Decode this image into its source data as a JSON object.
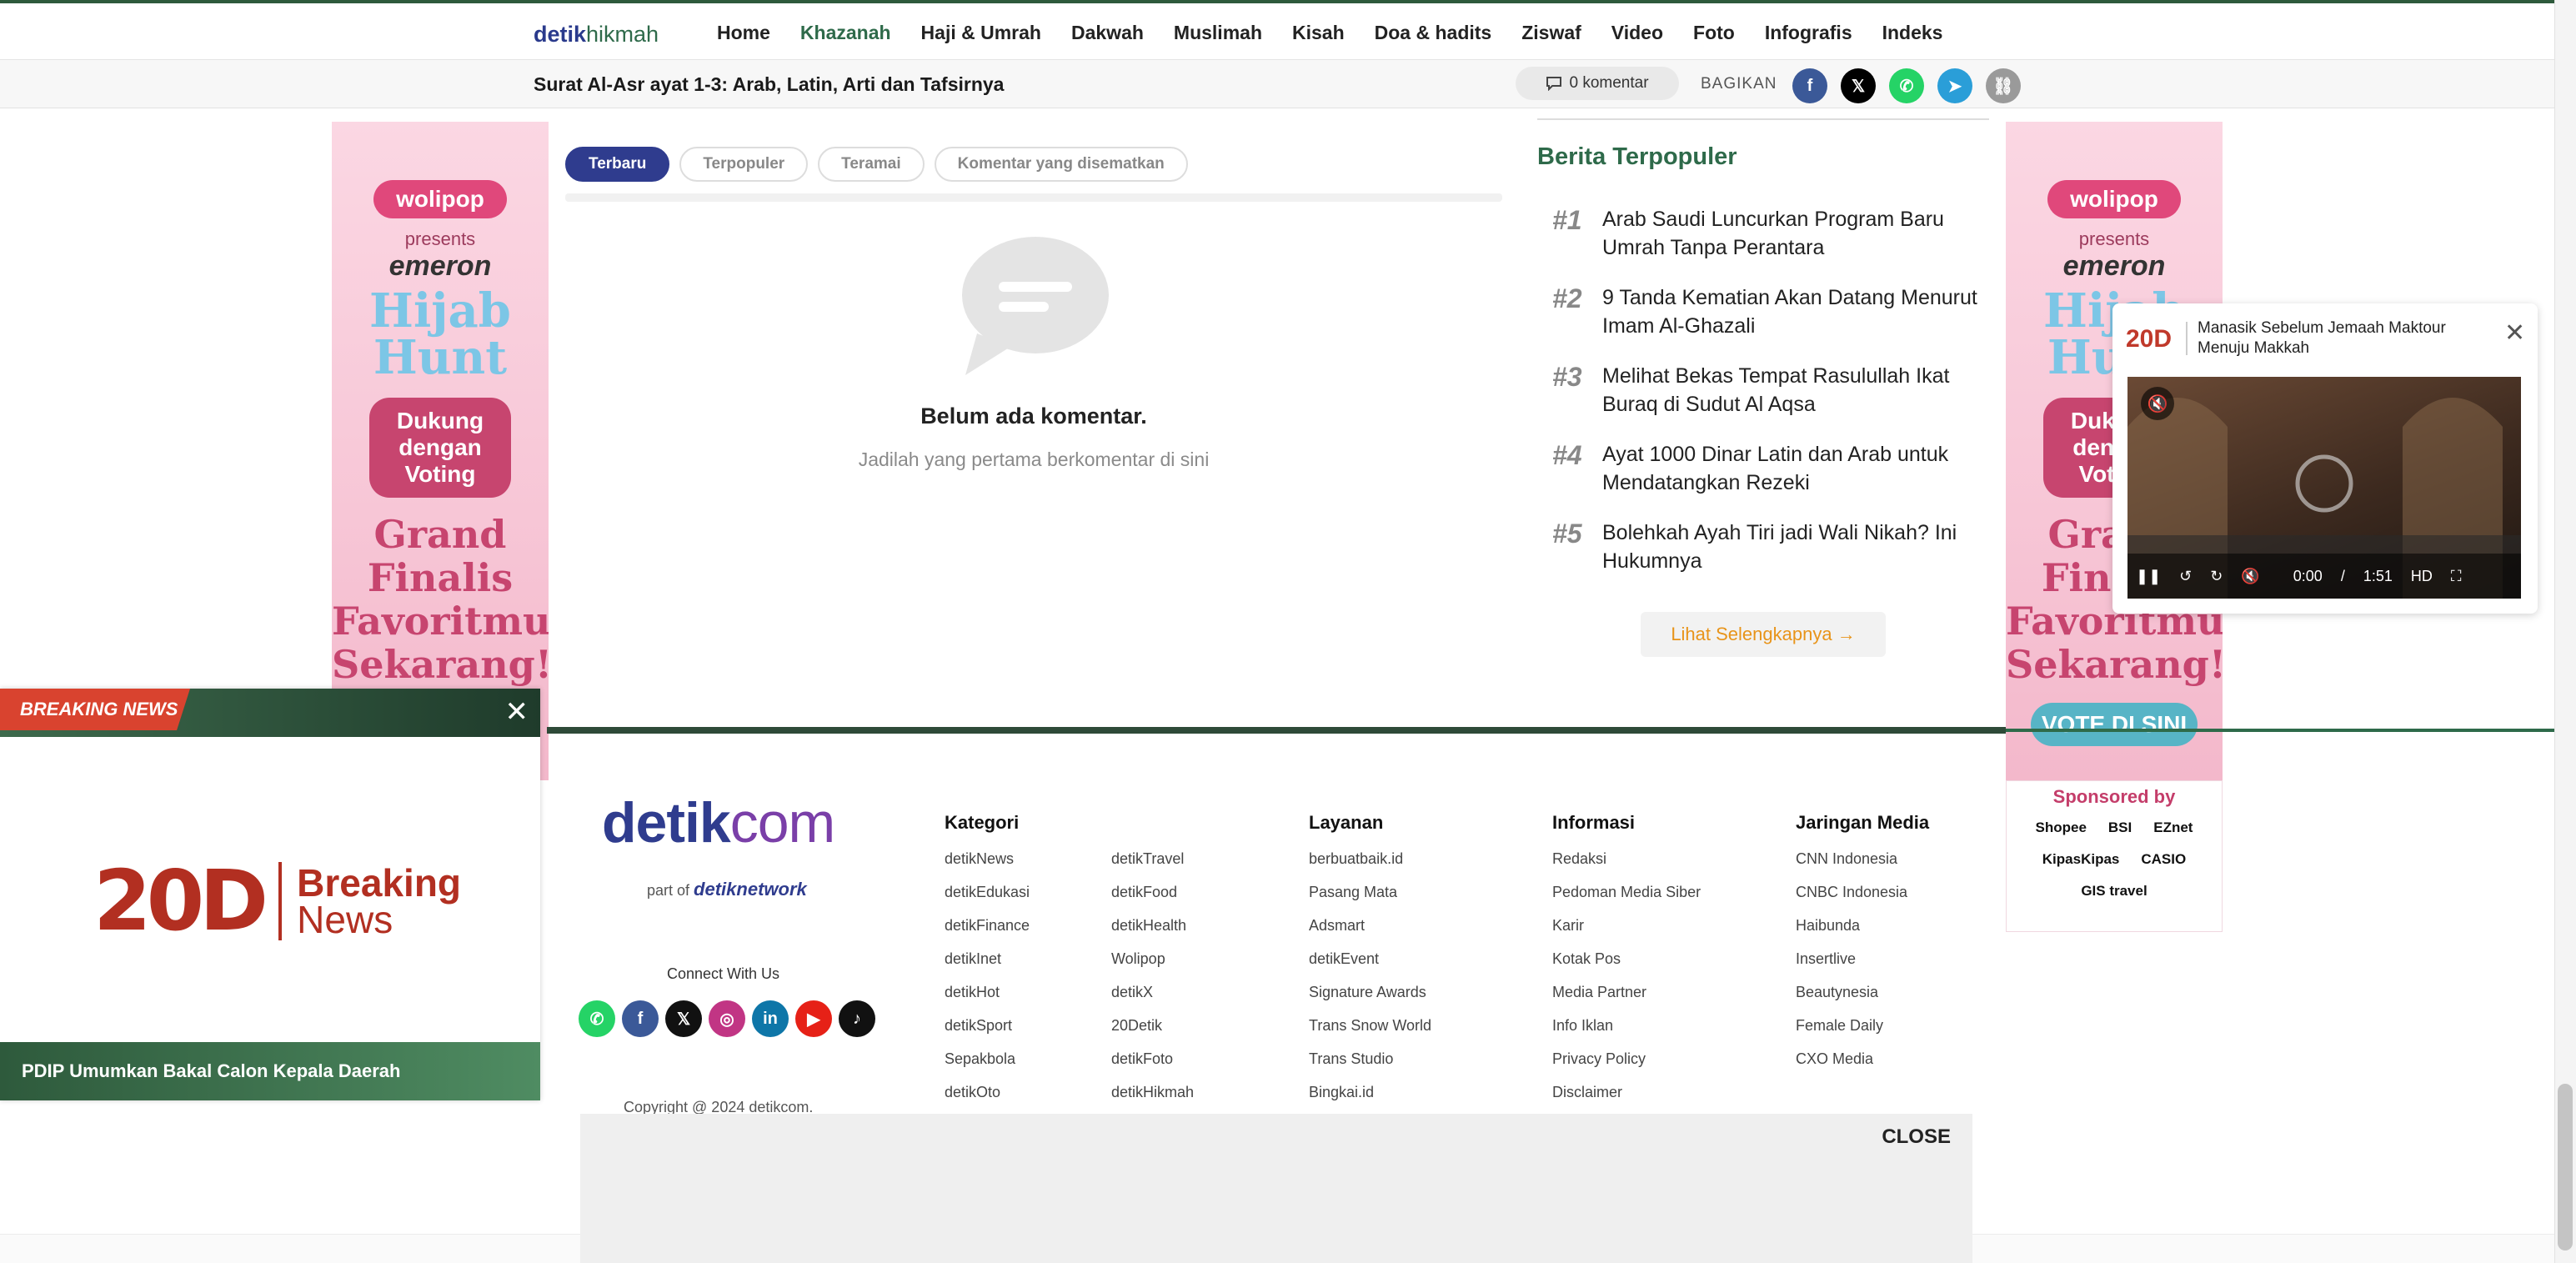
{
  "nav": {
    "logo_bold": "detik",
    "logo_light": "hikmah",
    "links": [
      "Home",
      "Khazanah",
      "Haji & Umrah",
      "Dakwah",
      "Muslimah",
      "Kisah",
      "Doa & hadits",
      "Ziswaf",
      "Video",
      "Foto",
      "Infografis",
      "Indeks"
    ],
    "active": "Khazanah"
  },
  "article_bar": {
    "title": "Surat Al-Asr ayat 1-3: Arab, Latin, Arti dan Tafsirnya",
    "comment_count": "0 komentar",
    "share_label": "BAGIKAN",
    "share_icons": [
      "facebook-icon",
      "x-icon",
      "whatsapp-icon",
      "telegram-icon",
      "link-icon"
    ],
    "share_colors": [
      "#3b5998",
      "#000000",
      "#25d366",
      "#2a9ed8",
      "#9a9a9a"
    ]
  },
  "comments": {
    "tabs": [
      "Terbaru",
      "Terpopuler",
      "Teramai",
      "Komentar yang disematkan"
    ],
    "active_tab": "Terbaru",
    "empty_title": "Belum ada komentar.",
    "empty_sub": "Jadilah yang pertama berkomentar di sini"
  },
  "popular": {
    "title": "Berita Terpopuler",
    "items": [
      {
        "rank": "#1",
        "text": "Arab Saudi Luncurkan Program Baru Umrah Tanpa Perantara"
      },
      {
        "rank": "#2",
        "text": "9 Tanda Kematian Akan Datang Menurut Imam Al-Ghazali"
      },
      {
        "rank": "#3",
        "text": "Melihat Bekas Tempat Rasulullah Ikat Buraq di Sudut Al Aqsa"
      },
      {
        "rank": "#4",
        "text": "Ayat 1000 Dinar Latin dan Arab untuk Mendatangkan Rezeki"
      },
      {
        "rank": "#5",
        "text": "Bolehkah Ayah Tiri jadi Wali Nikah? Ini Hukumnya"
      }
    ],
    "more": "Lihat Selengkapnya →"
  },
  "side_ad": {
    "brand": "wolipop",
    "presents": "presents",
    "emeron": "emeron",
    "hijab": "Hijab Hunt",
    "dukung": "Dukung dengan Voting",
    "grand": "Grand Finalis Favoritmu Sekarang!",
    "vote": "VOTE DI SINI",
    "sponsored_by": "Sponsored by",
    "sponsors": [
      "Shopee",
      "BSI",
      "EZnet",
      "KipasKipas",
      "CASIO",
      "GIS travel"
    ]
  },
  "video": {
    "logo": "20D",
    "title": "Manasik Sebelum Jemaah Maktour Menuju Makkah",
    "time_current": "0:00",
    "time_sep": "/",
    "time_total": "1:51"
  },
  "footer": {
    "logo_main": "detik",
    "logo_com": "com",
    "part_of": "part of",
    "network": "detiknetwork",
    "connect": "Connect With Us",
    "social_icons": [
      "whatsapp-icon",
      "facebook-icon",
      "x-icon",
      "instagram-icon",
      "linkedin-icon",
      "youtube-icon",
      "tiktok-icon"
    ],
    "social_colors": [
      "#25d366",
      "#3b5998",
      "#111111",
      "#c13584",
      "#0e76a8",
      "#e62117",
      "#111111"
    ],
    "copyright": "Copyright @ 2024 detikcom.",
    "kategori_title": "Kategori",
    "kategori_col1": [
      "detikNews",
      "detikEdukasi",
      "detikFinance",
      "detikInet",
      "detikHot",
      "detikSport",
      "Sepakbola",
      "detikOto"
    ],
    "kategori_col2": [
      "detikTravel",
      "detikFood",
      "detikHealth",
      "Wolipop",
      "detikX",
      "20Detik",
      "detikFoto",
      "detikHikmah"
    ],
    "layanan_title": "Layanan",
    "layanan": [
      "berbuatbaik.id",
      "Pasang Mata",
      "Adsmart",
      "detikEvent",
      "Signature Awards",
      "Trans Snow World",
      "Trans Studio",
      "Bingkai.id"
    ],
    "informasi_title": "Informasi",
    "informasi": [
      "Redaksi",
      "Pedoman Media Siber",
      "Karir",
      "Kotak Pos",
      "Media Partner",
      "Info Iklan",
      "Privacy Policy",
      "Disclaimer"
    ],
    "jaringan_title": "Jaringan Media",
    "jaringan": [
      "CNN Indonesia",
      "CNBC Indonesia",
      "Haibunda",
      "Insertlive",
      "Beautynesia",
      "Female Daily",
      "CXO Media"
    ]
  },
  "breaking": {
    "tag": "BREAKING NEWS",
    "logo_num": "20D",
    "logo_word1": "Breaking",
    "logo_word2": "News",
    "headline": "PDIP Umumkan Bakal Calon Kepala Daerah"
  },
  "bottom_ad": {
    "close": "CLOSE"
  }
}
